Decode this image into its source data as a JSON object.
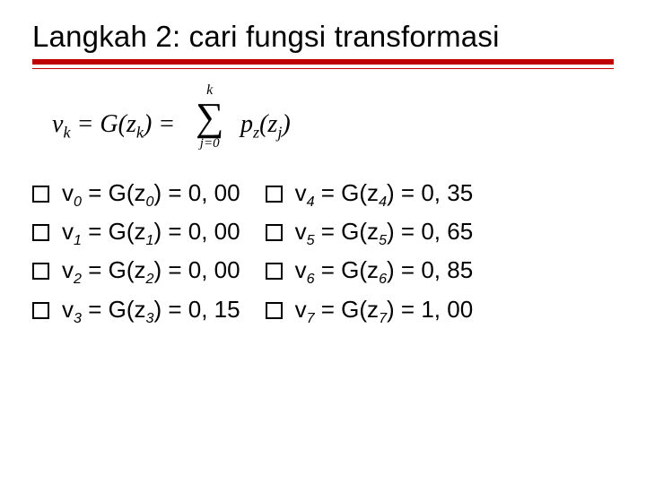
{
  "title": "Langkah 2: cari fungsi transformasi",
  "formula": {
    "lhs": "v_k = G(z_k) =",
    "sum_top": "k",
    "sum_bottom": "j=0",
    "rhs": "p_z(z_j)"
  },
  "left_col": [
    {
      "v": "v",
      "vi": "0",
      "g": "G(z",
      "gi": "0",
      "val": "0, 00"
    },
    {
      "v": "v",
      "vi": "1",
      "g": "G(z",
      "gi": "1",
      "val": "0, 00"
    },
    {
      "v": "v",
      "vi": "2",
      "g": "G(z",
      "gi": "2",
      "val": "0, 00"
    },
    {
      "v": "v",
      "vi": "3",
      "g": "G(z",
      "gi": "3",
      "val": "0, 15"
    }
  ],
  "right_col": [
    {
      "v": "v",
      "vi": "4",
      "g": "G(z",
      "gi": "4",
      "val": "0, 35"
    },
    {
      "v": "v",
      "vi": "5",
      "g": "G(z",
      "gi": "5",
      "val": "0, 65"
    },
    {
      "v": "v",
      "vi": "6",
      "g": "G(z",
      "gi": "6",
      "val": "0, 85"
    },
    {
      "v": "v",
      "vi": "7",
      "g": "G(z",
      "gi": "7",
      "val": "1, 00"
    }
  ]
}
